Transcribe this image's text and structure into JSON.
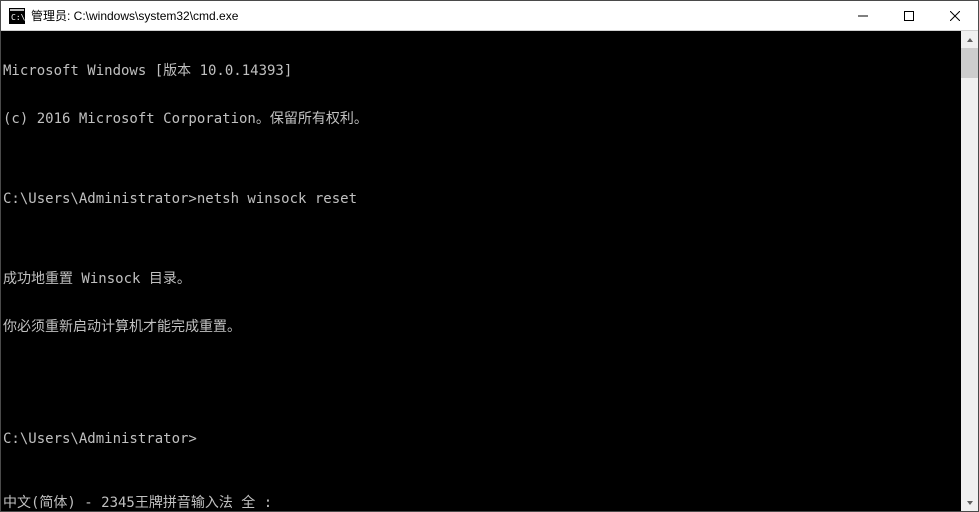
{
  "titlebar": {
    "title": "管理员: C:\\windows\\system32\\cmd.exe",
    "icon_name": "cmd-icon"
  },
  "window_controls": {
    "minimize_name": "minimize-button",
    "maximize_name": "maximize-button",
    "close_name": "close-button"
  },
  "terminal": {
    "lines": [
      "Microsoft Windows [版本 10.0.14393]",
      "(c) 2016 Microsoft Corporation。保留所有权利。",
      "",
      "C:\\Users\\Administrator>netsh winsock reset",
      "",
      "成功地重置 Winsock 目录。",
      "你必须重新启动计算机才能完成重置。",
      "",
      "",
      "C:\\Users\\Administrator>"
    ],
    "prompt_path": "C:\\Users\\Administrator>",
    "last_command": "netsh winsock reset",
    "ime_status": "中文(简体) - 2345王牌拼音输入法 全 :"
  },
  "colors": {
    "terminal_bg": "#000000",
    "terminal_fg": "#c0c0c0",
    "titlebar_bg": "#ffffff",
    "scrollbar_bg": "#f0f0f0",
    "scrollbar_thumb": "#cdcdcd"
  }
}
